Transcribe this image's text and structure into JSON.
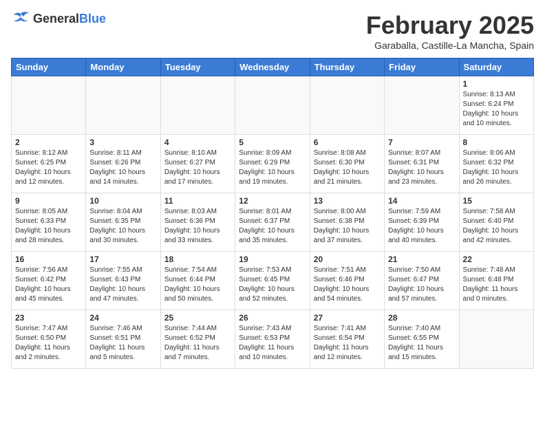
{
  "header": {
    "logo_general": "General",
    "logo_blue": "Blue",
    "title": "February 2025",
    "location": "Garaballa, Castille-La Mancha, Spain"
  },
  "weekdays": [
    "Sunday",
    "Monday",
    "Tuesday",
    "Wednesday",
    "Thursday",
    "Friday",
    "Saturday"
  ],
  "weeks": [
    [
      {
        "day": "",
        "info": ""
      },
      {
        "day": "",
        "info": ""
      },
      {
        "day": "",
        "info": ""
      },
      {
        "day": "",
        "info": ""
      },
      {
        "day": "",
        "info": ""
      },
      {
        "day": "",
        "info": ""
      },
      {
        "day": "1",
        "info": "Sunrise: 8:13 AM\nSunset: 6:24 PM\nDaylight: 10 hours\nand 10 minutes."
      }
    ],
    [
      {
        "day": "2",
        "info": "Sunrise: 8:12 AM\nSunset: 6:25 PM\nDaylight: 10 hours\nand 12 minutes."
      },
      {
        "day": "3",
        "info": "Sunrise: 8:11 AM\nSunset: 6:26 PM\nDaylight: 10 hours\nand 14 minutes."
      },
      {
        "day": "4",
        "info": "Sunrise: 8:10 AM\nSunset: 6:27 PM\nDaylight: 10 hours\nand 17 minutes."
      },
      {
        "day": "5",
        "info": "Sunrise: 8:09 AM\nSunset: 6:29 PM\nDaylight: 10 hours\nand 19 minutes."
      },
      {
        "day": "6",
        "info": "Sunrise: 8:08 AM\nSunset: 6:30 PM\nDaylight: 10 hours\nand 21 minutes."
      },
      {
        "day": "7",
        "info": "Sunrise: 8:07 AM\nSunset: 6:31 PM\nDaylight: 10 hours\nand 23 minutes."
      },
      {
        "day": "8",
        "info": "Sunrise: 8:06 AM\nSunset: 6:32 PM\nDaylight: 10 hours\nand 26 minutes."
      }
    ],
    [
      {
        "day": "9",
        "info": "Sunrise: 8:05 AM\nSunset: 6:33 PM\nDaylight: 10 hours\nand 28 minutes."
      },
      {
        "day": "10",
        "info": "Sunrise: 8:04 AM\nSunset: 6:35 PM\nDaylight: 10 hours\nand 30 minutes."
      },
      {
        "day": "11",
        "info": "Sunrise: 8:03 AM\nSunset: 6:36 PM\nDaylight: 10 hours\nand 33 minutes."
      },
      {
        "day": "12",
        "info": "Sunrise: 8:01 AM\nSunset: 6:37 PM\nDaylight: 10 hours\nand 35 minutes."
      },
      {
        "day": "13",
        "info": "Sunrise: 8:00 AM\nSunset: 6:38 PM\nDaylight: 10 hours\nand 37 minutes."
      },
      {
        "day": "14",
        "info": "Sunrise: 7:59 AM\nSunset: 6:39 PM\nDaylight: 10 hours\nand 40 minutes."
      },
      {
        "day": "15",
        "info": "Sunrise: 7:58 AM\nSunset: 6:40 PM\nDaylight: 10 hours\nand 42 minutes."
      }
    ],
    [
      {
        "day": "16",
        "info": "Sunrise: 7:56 AM\nSunset: 6:42 PM\nDaylight: 10 hours\nand 45 minutes."
      },
      {
        "day": "17",
        "info": "Sunrise: 7:55 AM\nSunset: 6:43 PM\nDaylight: 10 hours\nand 47 minutes."
      },
      {
        "day": "18",
        "info": "Sunrise: 7:54 AM\nSunset: 6:44 PM\nDaylight: 10 hours\nand 50 minutes."
      },
      {
        "day": "19",
        "info": "Sunrise: 7:53 AM\nSunset: 6:45 PM\nDaylight: 10 hours\nand 52 minutes."
      },
      {
        "day": "20",
        "info": "Sunrise: 7:51 AM\nSunset: 6:46 PM\nDaylight: 10 hours\nand 54 minutes."
      },
      {
        "day": "21",
        "info": "Sunrise: 7:50 AM\nSunset: 6:47 PM\nDaylight: 10 hours\nand 57 minutes."
      },
      {
        "day": "22",
        "info": "Sunrise: 7:48 AM\nSunset: 6:48 PM\nDaylight: 11 hours\nand 0 minutes."
      }
    ],
    [
      {
        "day": "23",
        "info": "Sunrise: 7:47 AM\nSunset: 6:50 PM\nDaylight: 11 hours\nand 2 minutes."
      },
      {
        "day": "24",
        "info": "Sunrise: 7:46 AM\nSunset: 6:51 PM\nDaylight: 11 hours\nand 5 minutes."
      },
      {
        "day": "25",
        "info": "Sunrise: 7:44 AM\nSunset: 6:52 PM\nDaylight: 11 hours\nand 7 minutes."
      },
      {
        "day": "26",
        "info": "Sunrise: 7:43 AM\nSunset: 6:53 PM\nDaylight: 11 hours\nand 10 minutes."
      },
      {
        "day": "27",
        "info": "Sunrise: 7:41 AM\nSunset: 6:54 PM\nDaylight: 11 hours\nand 12 minutes."
      },
      {
        "day": "28",
        "info": "Sunrise: 7:40 AM\nSunset: 6:55 PM\nDaylight: 11 hours\nand 15 minutes."
      },
      {
        "day": "",
        "info": ""
      }
    ]
  ]
}
